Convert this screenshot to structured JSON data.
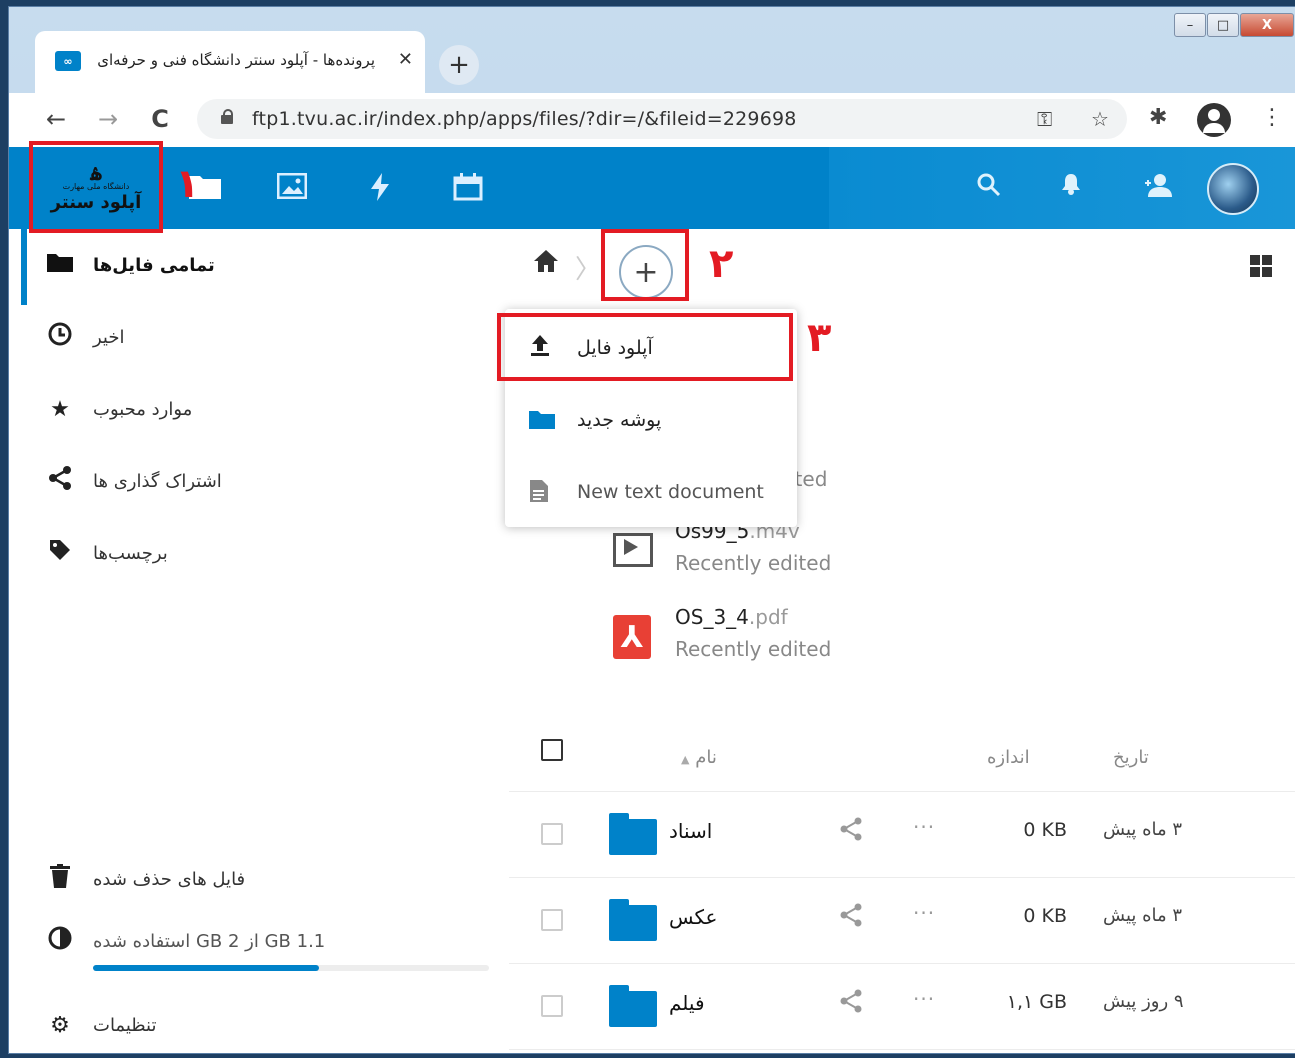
{
  "browser": {
    "tab_title": "پرونده‌ها - آپلود سنتر دانشگاه فنی و حرفه‌ای",
    "tab_favicon": "∞",
    "tab_close": "✕",
    "new_tab": "+",
    "url": "ftp1.tvu.ac.ir/index.php/apps/files/?dir=/&fileid=229698",
    "back": "←",
    "forward": "→",
    "reload": "C",
    "key_icon": "⚿",
    "star_icon": "☆",
    "extensions_icon": "✱",
    "menu_icon": "⋮",
    "minimize": "–",
    "maximize": "□",
    "close": "X"
  },
  "header": {
    "logo_mark": "ۿ",
    "logo_small": "دانشگاه ملی مهارت",
    "logo_text": "آپلود سنتر",
    "files_icon": "folder-icon",
    "search_icon": "⌕",
    "bell_icon": "🔔",
    "contacts_icon": "👤"
  },
  "annotations": {
    "n1": "۱",
    "n2": "۲",
    "n3": "۳"
  },
  "sidebar": {
    "items": [
      {
        "label": "تمامی فایل‌ها",
        "icon": "■"
      },
      {
        "label": "اخیر",
        "icon": "◷"
      },
      {
        "label": "موارد محبوب",
        "icon": "★"
      },
      {
        "label": "اشتراک گذاری ها",
        "icon": "<"
      },
      {
        "label": "برچسب‌ها",
        "icon": "◆"
      }
    ],
    "trash": {
      "label": "فایل های حذف شده",
      "icon": "🗑"
    },
    "quota": {
      "label": "1.1 GB از 2 GB استفاده شده",
      "percent": 57,
      "icon": "◐"
    },
    "settings": {
      "label": "تنظیمات",
      "icon": "⚙"
    }
  },
  "main": {
    "home_icon": "⌂",
    "add_label": "+",
    "menu": [
      {
        "label": "آپلود فایل",
        "icon": "⭱"
      },
      {
        "label": "پوشه جدید",
        "icon": "▬"
      },
      {
        "label": "New text document",
        "icon": "▤"
      }
    ],
    "recent_partial": {
      "ext": "v",
      "sub": "ited"
    },
    "recent": [
      {
        "name": "Os99_5",
        "ext": ".m4v",
        "sub": "Recently edited"
      },
      {
        "name": "OS_3_4",
        "ext": ".pdf",
        "sub": "Recently edited"
      }
    ],
    "table": {
      "col_name": "نام",
      "sort_icon": "▲",
      "col_size": "اندازه",
      "col_date": "تاریخ",
      "rows": [
        {
          "name": "اسناد",
          "size": "0 KB",
          "date": "۳ ماه پیش"
        },
        {
          "name": "عکس",
          "size": "0 KB",
          "date": "۳ ماه پیش"
        },
        {
          "name": "فیلم",
          "size": "۱,۱ GB",
          "date": "۹ روز پیش"
        }
      ],
      "share_icon": "<",
      "more_icon": "···"
    }
  }
}
